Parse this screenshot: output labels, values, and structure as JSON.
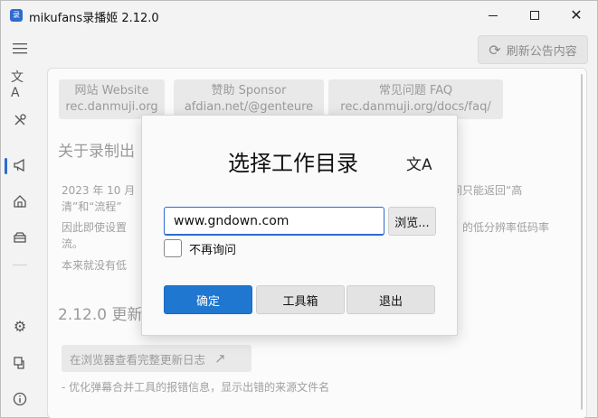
{
  "window": {
    "icon_text": "录",
    "title": "mikufans录播姬 2.12.0"
  },
  "toolbar": {
    "refresh_label": "刷新公告内容"
  },
  "links": [
    {
      "title": "网站 Website",
      "url": "rec.danmuji.org"
    },
    {
      "title": "赞助 Sponsor",
      "url": "afdian.net/@genteure"
    },
    {
      "title": "常见问题 FAQ",
      "url": "rec.danmuji.org/docs/faq/"
    }
  ],
  "announcement": {
    "heading": "关于录制出",
    "line1_left": "2023 年 10 月",
    "line1_right": "间只能返回“高",
    "line2_left": "清”和“流程”",
    "line3_left": "因此即使设置",
    "line3_right": "的低分辨率低码率",
    "line4_left": "流。",
    "line5_left": "本来就没有低",
    "changelog_heading": "2.12.0 更新",
    "changelog_button": "在浏览器查看完整更新日志",
    "changelog_item": "- 优化弹幕合并工具的报错信息，显示出错的来源文件名"
  },
  "dialog": {
    "title": "选择工作目录",
    "path_value": "www.gndown.com",
    "browse_label": "浏览...",
    "dont_ask_label": "不再询问",
    "dont_ask_checked": false,
    "ok_label": "确定",
    "toolbox_label": "工具箱",
    "exit_label": "退出"
  },
  "colors": {
    "accent": "#1f77d0"
  }
}
